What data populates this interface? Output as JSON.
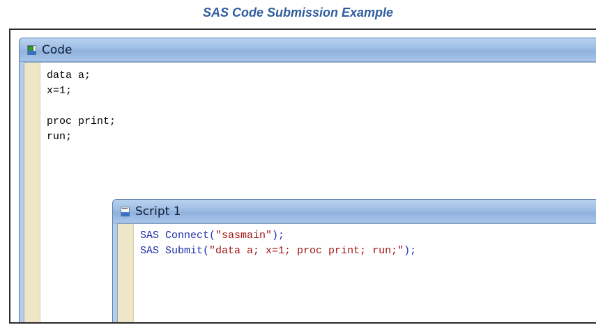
{
  "caption": "SAS Code Submission Example",
  "code_window": {
    "title": "Code",
    "icon": "jrp-code-icon",
    "lines": [
      "data a;",
      "x=1;",
      "",
      "proc print;",
      "run;"
    ]
  },
  "script_window": {
    "title": "Script 1",
    "icon": "jsl-script-icon",
    "lines": [
      {
        "fn": "SAS Connect(",
        "str": "\"sasmain\"",
        "end": ");"
      },
      {
        "fn": "SAS Submit(",
        "str": "\"data a; x=1; proc print; run;\"",
        "end": ");"
      }
    ]
  },
  "colors": {
    "caption": "#2f5d9e",
    "function_text": "#1f2fa8",
    "string_text": "#a01515",
    "gutter": "#efe6c8",
    "title_bar": "#9dbde4"
  }
}
